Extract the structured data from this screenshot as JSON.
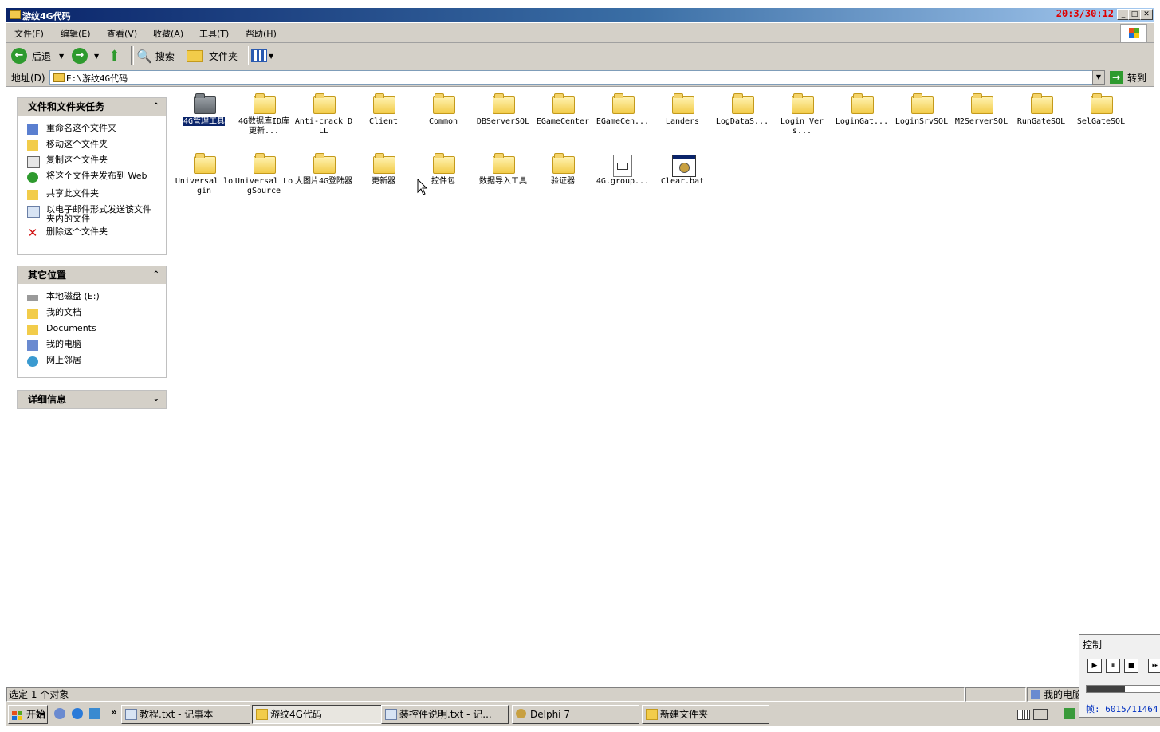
{
  "window": {
    "title": "游纹4G代码",
    "clock": "20:3/30:12"
  },
  "menu": [
    "文件(F)",
    "编辑(E)",
    "查看(V)",
    "收藏(A)",
    "工具(T)",
    "帮助(H)"
  ],
  "toolbar": {
    "back": "后退",
    "search": "搜索",
    "folders": "文件夹"
  },
  "address": {
    "label": "地址(D)",
    "value": "E:\\游纹4G代码",
    "go": "转到"
  },
  "tasks": {
    "title": "文件和文件夹任务",
    "items": [
      "重命名这个文件夹",
      "移动这个文件夹",
      "复制这个文件夹",
      "将这个文件夹发布到 Web",
      "共享此文件夹",
      "以电子邮件形式发送该文件夹内的文件",
      "删除这个文件夹"
    ]
  },
  "other": {
    "title": "其它位置",
    "items": [
      "本地磁盘 (E:)",
      "我的文档",
      "Documents",
      "我的电脑",
      "网上邻居"
    ]
  },
  "details": {
    "title": "详细信息"
  },
  "files": [
    {
      "name": "4G管理工具",
      "type": "folder-selected"
    },
    {
      "name": "4G数据库ID库更新...",
      "type": "folder"
    },
    {
      "name": "Anti-crack DLL",
      "type": "folder"
    },
    {
      "name": "Client",
      "type": "folder"
    },
    {
      "name": "Common",
      "type": "folder"
    },
    {
      "name": "DBServerSQL",
      "type": "folder"
    },
    {
      "name": "EGameCenter",
      "type": "folder"
    },
    {
      "name": "EGameCen...",
      "type": "folder"
    },
    {
      "name": "Landers",
      "type": "folder"
    },
    {
      "name": "LogDataS...",
      "type": "folder"
    },
    {
      "name": "Login Vers...",
      "type": "folder"
    },
    {
      "name": "LoginGat...",
      "type": "folder"
    },
    {
      "name": "LoginSrvSQL",
      "type": "folder"
    },
    {
      "name": "M2ServerSQL",
      "type": "folder"
    },
    {
      "name": "RunGateSQL",
      "type": "folder"
    },
    {
      "name": "SelGateSQL",
      "type": "folder"
    },
    {
      "name": "Universal login",
      "type": "folder"
    },
    {
      "name": "Universal LogSource",
      "type": "folder"
    },
    {
      "name": "大图片4G登陆器",
      "type": "folder"
    },
    {
      "name": "更新器",
      "type": "folder"
    },
    {
      "name": "控件包",
      "type": "folder"
    },
    {
      "name": "数据导入工具",
      "type": "folder"
    },
    {
      "name": "验证器",
      "type": "folder"
    },
    {
      "name": "4G.group...",
      "type": "doc"
    },
    {
      "name": "Clear.bat",
      "type": "bat"
    }
  ],
  "status": {
    "left": "选定 1 个对象",
    "right": "我的电脑"
  },
  "taskbar": {
    "start": "开始",
    "buttons": [
      "教程.txt - 记事本",
      "游纹4G代码",
      "装控件说明.txt - 记...",
      "Delphi 7",
      "新建文件夹"
    ]
  },
  "control": {
    "title": "控制",
    "frames": "帧: 6015/11464"
  }
}
